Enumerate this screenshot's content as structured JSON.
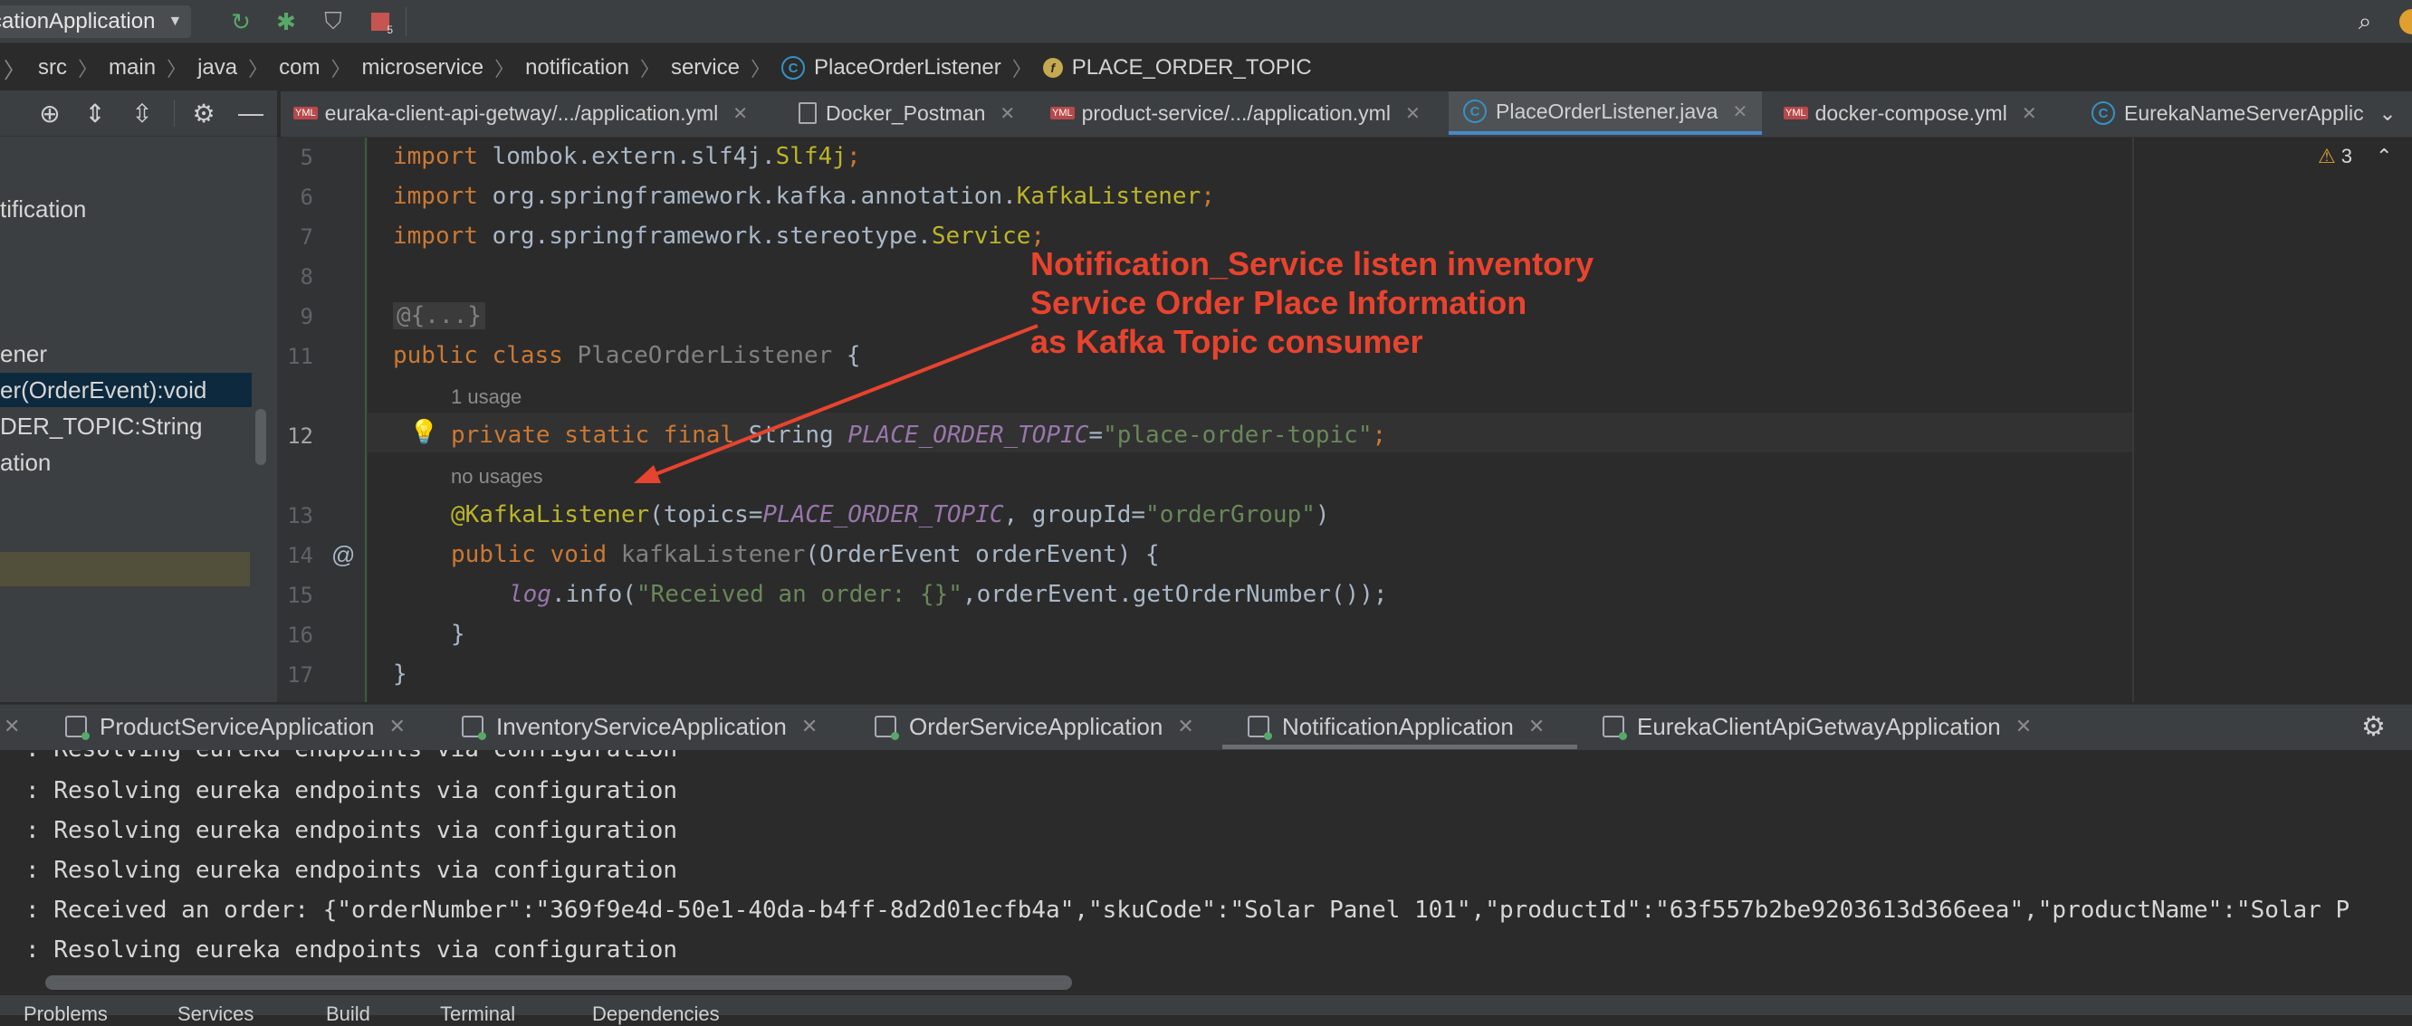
{
  "toolbar": {
    "run_config": "cationApplication",
    "stop_count": "5"
  },
  "breadcrumb": [
    "src",
    "main",
    "java",
    "com",
    "microservice",
    "notification",
    "service",
    "PlaceOrderListener",
    "PLACE_ORDER_TOPIC"
  ],
  "structure": {
    "items": [
      "tification",
      "ener",
      "er(OrderEvent):void",
      "DER_TOPIC:String",
      "ation"
    ]
  },
  "tabs": [
    {
      "label": "euraka-client-api-getway/.../application.yml",
      "kind": "yml"
    },
    {
      "label": "Docker_Postman",
      "kind": "doc"
    },
    {
      "label": "product-service/.../application.yml",
      "kind": "yml"
    },
    {
      "label": "PlaceOrderListener.java",
      "kind": "class",
      "active": true
    },
    {
      "label": "docker-compose.yml",
      "kind": "yml"
    },
    {
      "label": "EurekaNameServerApplic",
      "kind": "class"
    }
  ],
  "editor": {
    "warnings": "3",
    "lines": [
      "5",
      "6",
      "7",
      "8",
      "9",
      "11",
      "12",
      "13",
      "14",
      "15",
      "16",
      "17"
    ],
    "code": {
      "l5": {
        "kw": "import",
        "rest": " lombok.extern.slf4j.",
        "ann": "Slf4j",
        "end": ";"
      },
      "l6": {
        "kw": "import",
        "rest": " org.springframework.kafka.annotation.",
        "ann": "KafkaListener",
        "end": ";"
      },
      "l7": {
        "kw": "import",
        "rest": " org.springframework.stereotype.",
        "ann": "Service",
        "end": ";"
      },
      "l9": "@{...}",
      "l11": {
        "kw": "public class",
        "name": " PlaceOrderListener",
        "end": " {"
      },
      "hint1": "1 usage",
      "l12": {
        "kw": "private static final",
        "type": " String ",
        "const": "PLACE_ORDER_TOPIC",
        "eq": "=",
        "str": "\"place-order-topic\"",
        "end": ";"
      },
      "hint2": "no usages",
      "l13": {
        "ann": "@KafkaListener",
        "p1": "(topics=",
        "const": "PLACE_ORDER_TOPIC",
        "p2": ", groupId=",
        "str": "\"orderGroup\"",
        "p3": ")"
      },
      "l14": {
        "kw": "public void",
        "name": " kafkaListener",
        "rest": "(OrderEvent orderEvent) {"
      },
      "l15": {
        "log": "log",
        "rest1": ".info(",
        "str": "\"Received an order: {}\"",
        "rest2": ",orderEvent.getOrderNumber());"
      },
      "l16": "}",
      "l17": "}"
    }
  },
  "annotation": {
    "lines": [
      "Notification_Service listen inventory",
      "Service Order Place Information",
      "as Kafka Topic consumer"
    ],
    "color": "#e8432e"
  },
  "run_tabs": [
    "ProductServiceApplication",
    "InventoryServiceApplication",
    "OrderServiceApplication",
    "NotificationApplication",
    "EurekaClientApiGetwayApplication"
  ],
  "console": {
    "lines": [
      ": Resolving eureka endpoints via configuration",
      ": Resolving eureka endpoints via configuration",
      ": Resolving eureka endpoints via configuration",
      ": Resolving eureka endpoints via configuration",
      ": Received an order: {\"orderNumber\":\"369f9e4d-50e1-40da-b4ff-8d2d01ecfb4a\",\"skuCode\":\"Solar Panel 101\",\"productId\":\"63f557b2be9203613d366eea\",\"productName\":\"Solar P",
      ": Resolving eureka endpoints via configuration"
    ]
  },
  "bottom_bar": [
    "Problems",
    "Services",
    "Build",
    "Terminal",
    "Dependencies"
  ]
}
